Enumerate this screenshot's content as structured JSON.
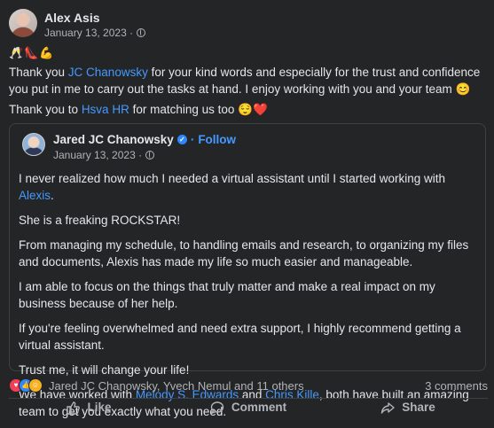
{
  "post": {
    "author": "Alex Asis",
    "date": "January 13, 2023 ·",
    "emoji_line": "🥂👠💪",
    "p1_a": "Thank you ",
    "p1_link": "JC Chanowsky",
    "p1_b": " for your kind words and especially for the trust and confidence you put in me to carry out the tasks at hand. I enjoy working with you and your team 😊",
    "p2_a": "Thank you to ",
    "p2_link": "Hsva HR",
    "p2_b": " for matching us too 😌❤️"
  },
  "shared": {
    "author": "Jared JC Chanowsky",
    "follow": "Follow",
    "dot": "·",
    "date": "January 13, 2023 ·",
    "paragraphs": {
      "p1_a": "I never realized how much I needed a virtual assistant until I started working with ",
      "p1_link": "Alexis",
      "p1_b": ".",
      "p2": "She is a freaking ROCKSTAR!",
      "p3": "From managing my schedule, to handling emails and research, to organizing my files and documents, Alexis has made my life so much easier and manageable.",
      "p4": "I am able to focus on the things that truly matter and make a real impact on my business because of her help.",
      "p5": "If you're feeling overwhelmed and need extra support, I highly recommend getting a virtual assistant.",
      "p6": "Trust me, it will change your life!",
      "p7_a": "We have worked with ",
      "p7_link1": "Melody S. Edwards",
      "p7_mid": " and ",
      "p7_link2": "Chris Kille",
      "p7_b": ", both have built an amazing team to get you exactly what you need."
    }
  },
  "reactions": {
    "names": "Jared JC Chanowsky, Yvech Nemul and 11 others",
    "comments": "3 comments"
  },
  "actions": {
    "like": "Like",
    "comment": "Comment",
    "share": "Share"
  },
  "colors": {
    "background": "#242526",
    "link": "#4599ff",
    "text": "#e4e6eb",
    "secondary": "#b0b3b8"
  }
}
